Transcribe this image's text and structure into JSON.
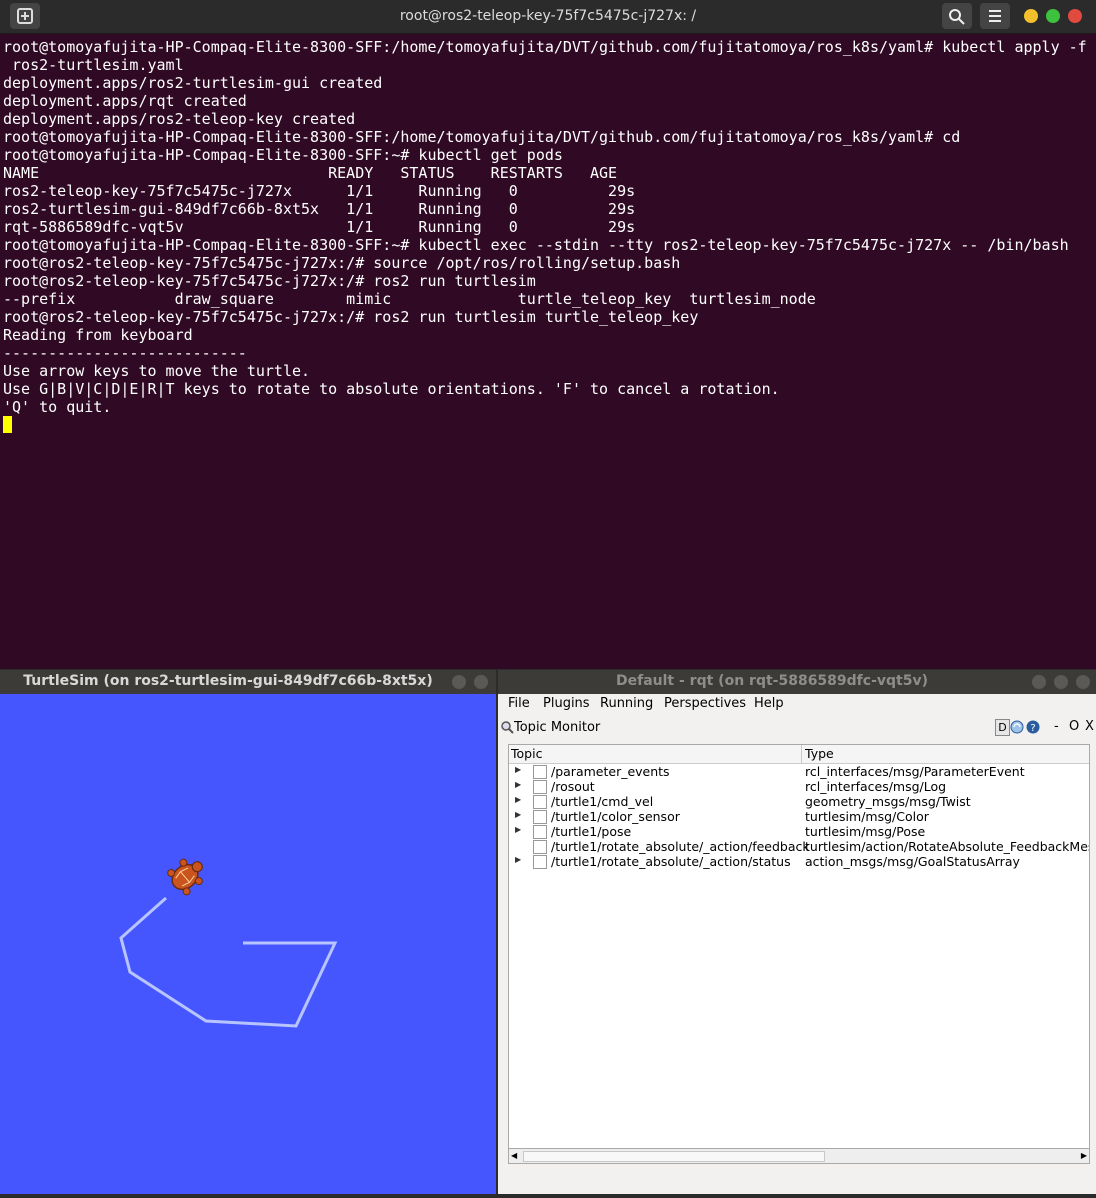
{
  "terminal": {
    "title": "root@ros2-teleop-key-75f7c5475c-j727x: /",
    "lines": [
      "root@tomoyafujita-HP-Compaq-Elite-8300-SFF:/home/tomoyafujita/DVT/github.com/fujitatomoya/ros_k8s/yaml# kubectl apply -f",
      " ros2-turtlesim.yaml",
      "deployment.apps/ros2-turtlesim-gui created",
      "deployment.apps/rqt created",
      "deployment.apps/ros2-teleop-key created",
      "root@tomoyafujita-HP-Compaq-Elite-8300-SFF:/home/tomoyafujita/DVT/github.com/fujitatomoya/ros_k8s/yaml# cd",
      "root@tomoyafujita-HP-Compaq-Elite-8300-SFF:~# kubectl get pods",
      "NAME                                READY   STATUS    RESTARTS   AGE",
      "ros2-teleop-key-75f7c5475c-j727x      1/1     Running   0          29s",
      "ros2-turtlesim-gui-849df7c66b-8xt5x   1/1     Running   0          29s",
      "rqt-5886589dfc-vqt5v                  1/1     Running   0          29s",
      "root@tomoyafujita-HP-Compaq-Elite-8300-SFF:~# kubectl exec --stdin --tty ros2-teleop-key-75f7c5475c-j727x -- /bin/bash",
      "root@ros2-teleop-key-75f7c5475c-j727x:/# source /opt/ros/rolling/setup.bash",
      "root@ros2-teleop-key-75f7c5475c-j727x:/# ros2 run turtlesim",
      "--prefix           draw_square        mimic              turtle_teleop_key  turtlesim_node",
      "root@ros2-teleop-key-75f7c5475c-j727x:/# ros2 run turtlesim turtle_teleop_key",
      "Reading from keyboard",
      "---------------------------",
      "Use arrow keys to move the turtle.",
      "Use G|B|V|C|D|E|R|T keys to rotate to absolute orientations. 'F' to cancel a rotation.",
      "'Q' to quit."
    ]
  },
  "turtlesim": {
    "title": "TurtleSim (on ros2-turtlesim-gui-849df7c66b-8xt5x)",
    "background": "#4556ff"
  },
  "rqt": {
    "title": "Default - rqt (on rqt-5886589dfc-vqt5v)",
    "menu": [
      "File",
      "Plugins",
      "Running",
      "Perspectives",
      "Help"
    ],
    "plugin_title": "Topic Monitor",
    "plugin_controls": [
      "D",
      "-",
      "O",
      "X"
    ],
    "columns": [
      "Topic",
      "Type"
    ],
    "topics": [
      {
        "topic": "/parameter_events",
        "type": "rcl_interfaces/msg/ParameterEvent",
        "expandable": true
      },
      {
        "topic": "/rosout",
        "type": "rcl_interfaces/msg/Log",
        "expandable": true
      },
      {
        "topic": "/turtle1/cmd_vel",
        "type": "geometry_msgs/msg/Twist",
        "expandable": true
      },
      {
        "topic": "/turtle1/color_sensor",
        "type": "turtlesim/msg/Color",
        "expandable": true
      },
      {
        "topic": "/turtle1/pose",
        "type": "turtlesim/msg/Pose",
        "expandable": true
      },
      {
        "topic": "/turtle1/rotate_absolute/_action/feedback",
        "type": "turtlesim/action/RotateAbsolute_FeedbackMess",
        "expandable": false
      },
      {
        "topic": "/turtle1/rotate_absolute/_action/status",
        "type": "action_msgs/msg/GoalStatusArray",
        "expandable": true
      }
    ]
  }
}
